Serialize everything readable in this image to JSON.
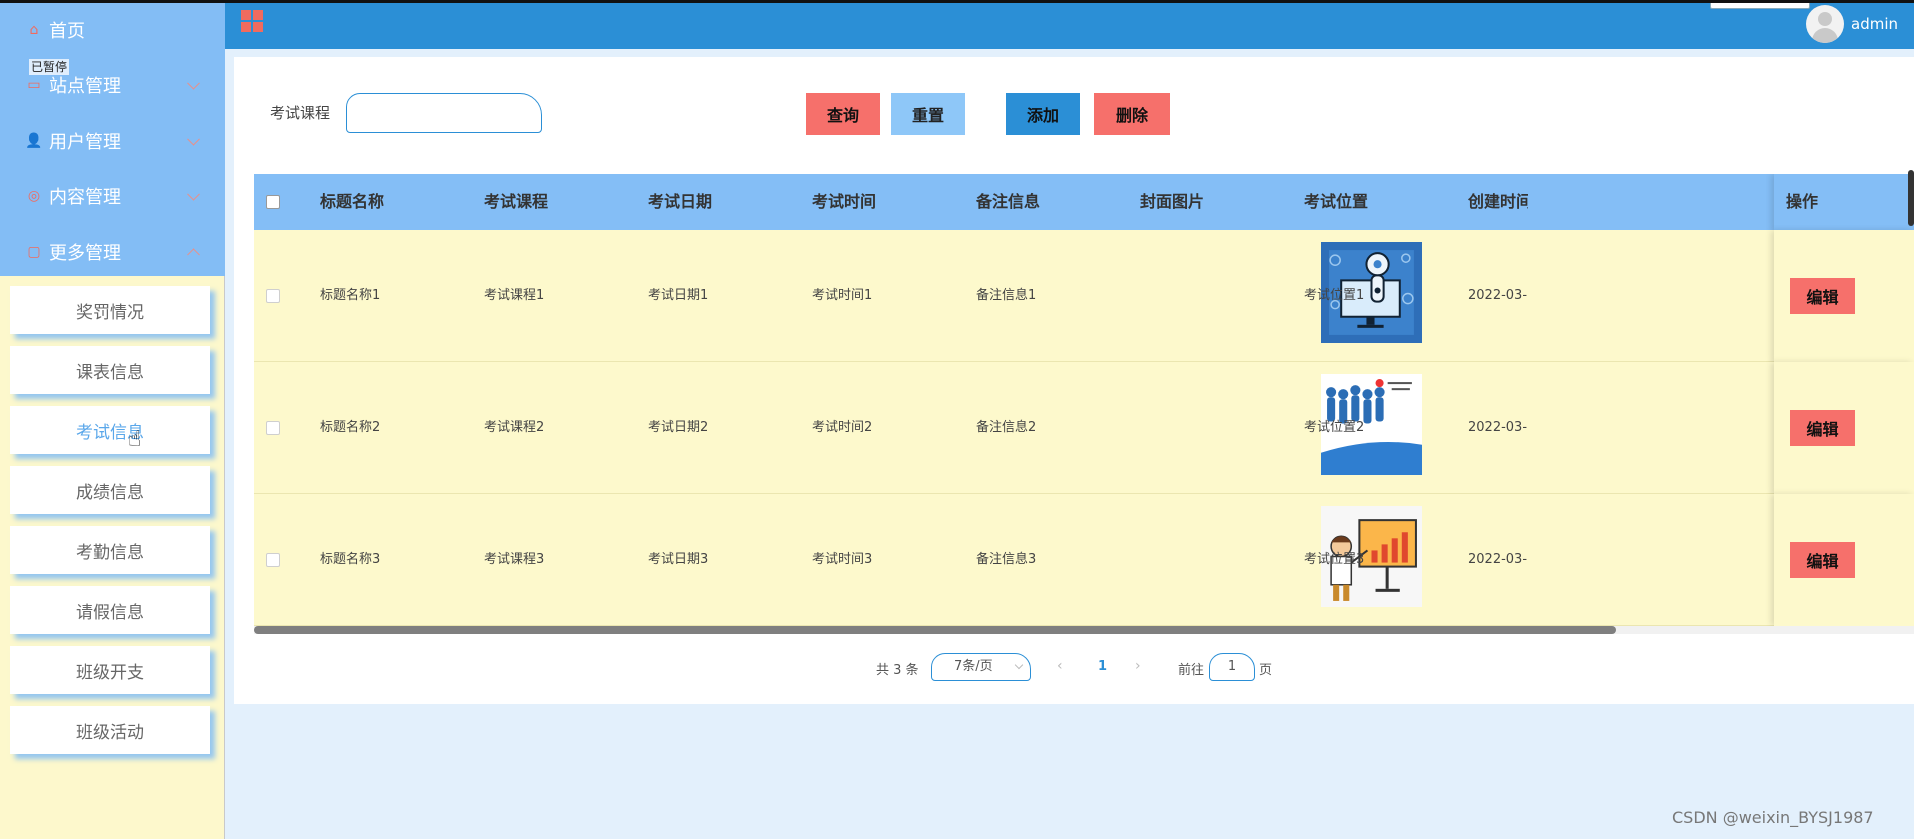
{
  "sidebar": {
    "paused_label": "已暂停",
    "menu": [
      {
        "label": "首页",
        "icon": "home-icon",
        "glyph": "⌂",
        "chevron": ""
      },
      {
        "label": "站点管理",
        "icon": "site-icon",
        "glyph": "▭",
        "chevron": "down"
      },
      {
        "label": "用户管理",
        "icon": "user-icon",
        "glyph": "👤",
        "chevron": "down"
      },
      {
        "label": "内容管理",
        "icon": "content-icon",
        "glyph": "◎",
        "chevron": "down"
      },
      {
        "label": "更多管理",
        "icon": "more-icon",
        "glyph": "▢",
        "chevron": "up"
      }
    ],
    "submenu": [
      {
        "label": "奖罚情况"
      },
      {
        "label": "课表信息"
      },
      {
        "label": "考试信息",
        "active": true
      },
      {
        "label": "成绩信息"
      },
      {
        "label": "考勤信息"
      },
      {
        "label": "请假信息"
      },
      {
        "label": "班级开支"
      },
      {
        "label": "班级活动"
      }
    ]
  },
  "header": {
    "user": "admin",
    "accent": "#2b8fd6"
  },
  "search": {
    "label": "考试课程",
    "value": ""
  },
  "buttons": {
    "query": "查询",
    "reset": "重置",
    "add": "添加",
    "delete": "删除",
    "edit": "编辑"
  },
  "table": {
    "columns": [
      "标题名称",
      "考试课程",
      "考试日期",
      "考试时间",
      "备注信息",
      "封面图片",
      "考试位置",
      "创建时间",
      "操作"
    ],
    "rows": [
      {
        "title": "标题名称1",
        "course": "考试课程1",
        "date": "考试日期1",
        "time": "考试时间1",
        "note": "备注信息1",
        "cover": "robot-image",
        "location": "考试位置1",
        "created": "2022-03-"
      },
      {
        "title": "标题名称2",
        "course": "考试课程2",
        "date": "考试日期2",
        "time": "考试时间2",
        "note": "备注信息2",
        "cover": "people-image",
        "location": "考试位置2",
        "created": "2022-03-"
      },
      {
        "title": "标题名称3",
        "course": "考试课程3",
        "date": "考试日期3",
        "time": "考试时间3",
        "note": "备注信息3",
        "cover": "presentation-image",
        "location": "考试位置3",
        "created": "2022-03-"
      }
    ]
  },
  "pagination": {
    "total": "共 3 条",
    "page_size": "7条/页",
    "current": "1",
    "goto_label": "前往",
    "goto_value": "1",
    "page_unit": "页"
  },
  "watermark": "CSDN @weixin_BYSJ1987"
}
